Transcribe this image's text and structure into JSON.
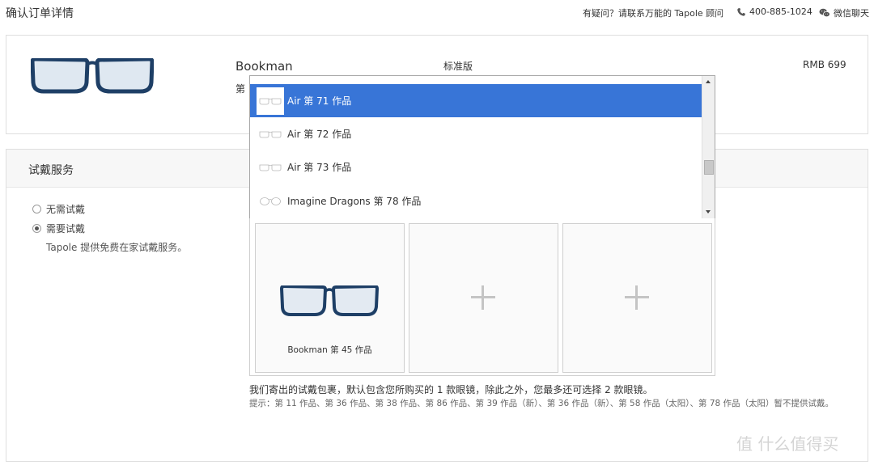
{
  "header": {
    "title": "确认订单详情",
    "help_text": "有疑问？请联系万能的 Tapole 顾问",
    "phone": "400-885-1024",
    "wechat": "微信聊天"
  },
  "product": {
    "name": "Bookman",
    "edition": "标准版",
    "price": "RMB 699",
    "work_prefix": "第"
  },
  "trial": {
    "title": "试戴服务",
    "option_none": "无需试戴",
    "option_need": "需要试戴",
    "selected": "需要试戴",
    "note": "Tapole 提供免费在家试戴服务。",
    "dropdown_options": [
      {
        "label": "Air 第 71 作品",
        "selected": true
      },
      {
        "label": "Air 第 72 作品",
        "selected": false
      },
      {
        "label": "Air 第 73 作品",
        "selected": false
      },
      {
        "label": "Imagine Dragons 第 78 作品",
        "selected": false
      }
    ],
    "slots": [
      {
        "label": "Bookman 第 45 作品",
        "filled": true
      },
      {
        "label": "",
        "filled": false
      },
      {
        "label": "",
        "filled": false
      }
    ],
    "info": "我们寄出的试戴包裹，默认包含您所购买的 1 款眼镜，除此之外，您最多还可选择 2 款眼镜。",
    "hint": "提示：第 11 作品、第 36 作品、第 38 作品、第 86 作品、第 39 作品（新）、第 36 作品（新）、第 58 作品（太阳）、第 78 作品（太阳）暂不提供试戴。"
  },
  "watermark": "值 什么值得买",
  "colors": {
    "accent_selected": "#3875d7",
    "frame_blue": "#1e3f66",
    "border": "#dedede"
  },
  "icons": [
    "phone-icon",
    "wechat-icon",
    "glasses-thumbnail",
    "plus-icon",
    "radio-icon",
    "scroll-up-icon",
    "scroll-down-icon"
  ]
}
